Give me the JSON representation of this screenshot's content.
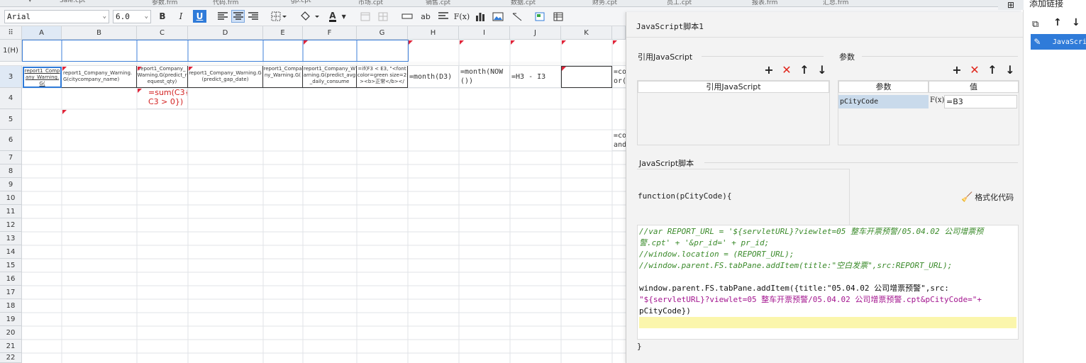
{
  "tabs": [
    "Sale.cpt",
    "参数.frm",
    "代码.frm",
    "gp.cpt",
    "市场.cpt",
    "销售.cpt",
    "数据.cpt",
    "财务.cpt",
    "员工.cpt",
    "报表.frm",
    "汇总.frm"
  ],
  "toolbar": {
    "font_name": "Arial",
    "font_size": "6.0",
    "bold": "B",
    "italic": "I",
    "underline": "U",
    "text_style": "ab",
    "formula": "F(x)",
    "font_color_letter": "A"
  },
  "columns": [
    "A",
    "B",
    "C",
    "D",
    "E",
    "F",
    "G",
    "H",
    "I",
    "J",
    "K"
  ],
  "rows": [
    "1(H)",
    "3",
    "4",
    "5",
    "6",
    "7",
    "8",
    "9",
    "10",
    "11",
    "12",
    "13",
    "14",
    "15",
    "16",
    "17",
    "18",
    "19",
    "20",
    "21",
    "22"
  ],
  "cells": {
    "a3": "report1_Company_Warning.G(",
    "b3": "report1_Company_Warning.G(citycompany_name)",
    "c3": "report1_Company_Warning.G(predict_request_qty)",
    "d3": "report1_Company_Warning.G(predict_gap_date)",
    "e3": "report1_Company_Warning.G(",
    "f3": "report1_Company_Warning.G(predict_avg_daily_consume",
    "g3": "=if(F3 < E3, \"<font color=green size=2><b>正常</b></",
    "h3": "=month(D3)",
    "i3": "=month(NOW())",
    "j3": "=H3 - I3",
    "l3": "=co\nor(",
    "c4": "=sum(C3{\nC3 > 0})",
    "l6": "=co\nand"
  },
  "panel": {
    "title": "JavaScript脚本1",
    "ref_section": "引用JavaScript",
    "ref_column": "引用JavaScript",
    "param_section": "参数",
    "param_col_name": "参数",
    "param_col_value": "值",
    "param_name": "pCityCode",
    "param_fx": "F(x)",
    "param_value": "=B3",
    "script_section": "JavaScript脚本",
    "function_signature": "function(pCityCode){",
    "format_button": "格式化代码",
    "code_lines": [
      "//var REPORT_URL = '${servletURL}?viewlet=05 整车开票预警/05.04.02 公司增票预",
      "警.cpt' + '&pr_id=' + pr_id;",
      "//window.location = (REPORT_URL);",
      "//window.parent.FS.tabPane.addItem(title:\"空白发票\",src:REPORT_URL);",
      "",
      "window.parent.FS.tabPane.addItem({title:\"05.04.02 公司增票预警\",src:",
      "\"${servletURL}?viewlet=05 整车开票预警/05.04.02 公司增票预警.cpt&pCityCode=\"+",
      "pCityCode})"
    ],
    "closing_brace": "}"
  },
  "right_panel": {
    "add_link": "添加链接",
    "list_item": "JavaScri"
  }
}
